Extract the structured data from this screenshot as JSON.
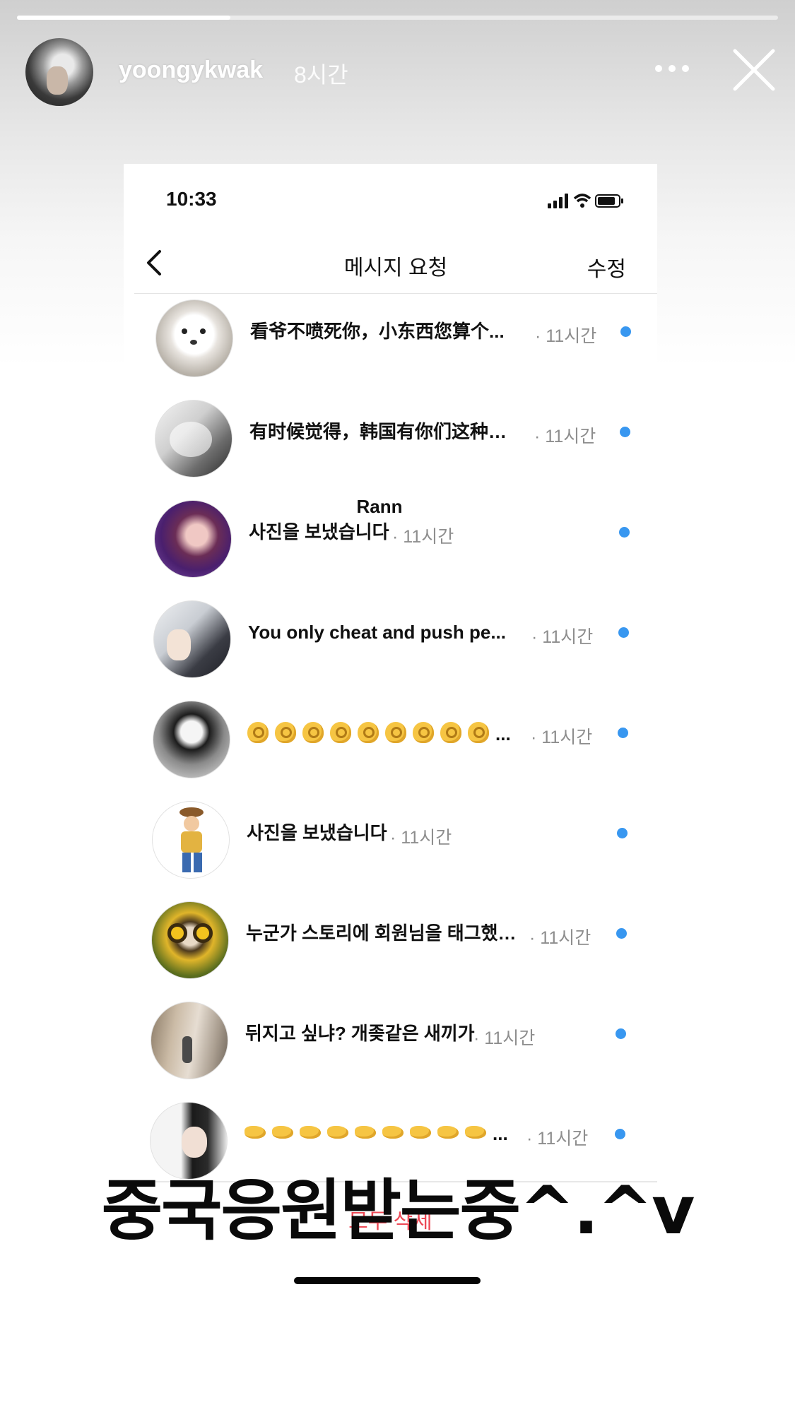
{
  "story": {
    "username": "yoongykwak",
    "time_ago": "8시간",
    "progress": 0.28
  },
  "screenshot": {
    "status_time": "10:33",
    "nav": {
      "title": "메시지 요청",
      "edit_label": "수정"
    },
    "requests": [
      {
        "name": "",
        "message": "看爷不喷死你，小东西您算个...",
        "time": "· 11시간",
        "avatar": "white-dog"
      },
      {
        "name": "",
        "message": "有时候觉得，韩国有你们这种…",
        "time": "· 11시간",
        "avatar": "grey-figure"
      },
      {
        "name": "_Rann",
        "message": "사진을 보냈습니다",
        "time": "· 11시간",
        "avatar": "purple-portrait"
      },
      {
        "name": "",
        "message": "You only cheat and push pe...",
        "time": "· 11시간",
        "avatar": "anime-couple"
      },
      {
        "name": "",
        "message": "...",
        "emoji_count": 9,
        "emoji": "ok-hand",
        "time": "· 11시간",
        "avatar": "manga-girl"
      },
      {
        "name": "",
        "message": "사진을 보냈습니다",
        "time": "· 11시간",
        "avatar": "cowboy-toy"
      },
      {
        "name": "",
        "message": "누군가 스토리에 회원님을 태그했…",
        "time": "· 11시간",
        "avatar": "sunflower"
      },
      {
        "name": "",
        "message": "뒤지고 싶냐? 개좆같은 새끼가",
        "time": "· 11시간",
        "avatar": "gallery"
      },
      {
        "name": "",
        "message": "...",
        "emoji_count": 9,
        "emoji": "pinching-hand",
        "time": "· 11시간",
        "avatar": "girl-portrait"
      }
    ],
    "delete_all_label": "모두 삭제"
  },
  "caption": "중국응원받는중^.^v",
  "colors": {
    "unread_dot": "#3897f0",
    "delete_red": "#ed4956",
    "time_grey": "#8e8e8e"
  }
}
